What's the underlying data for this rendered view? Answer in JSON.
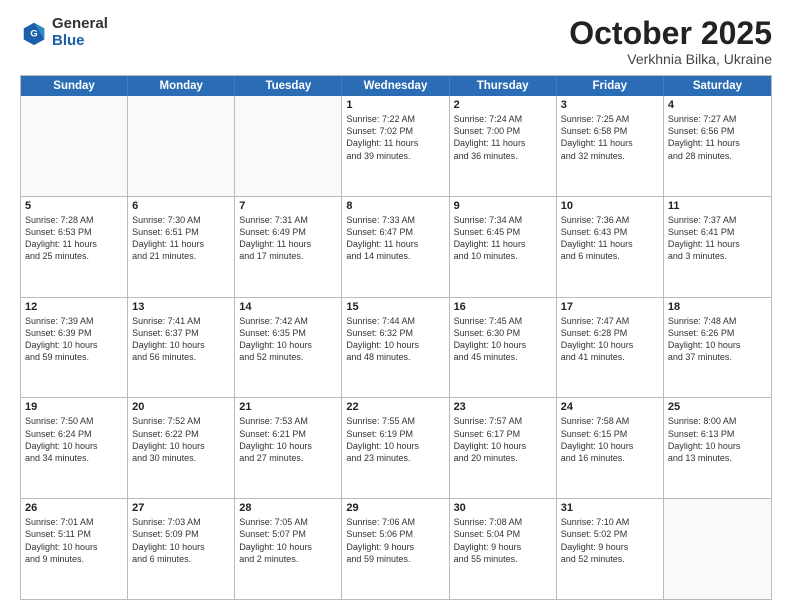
{
  "header": {
    "logo": {
      "general": "General",
      "blue": "Blue"
    },
    "month": "October 2025",
    "location": "Verkhnia Bilka, Ukraine"
  },
  "weekdays": [
    "Sunday",
    "Monday",
    "Tuesday",
    "Wednesday",
    "Thursday",
    "Friday",
    "Saturday"
  ],
  "rows": [
    [
      {
        "day": "",
        "text": "",
        "empty": true
      },
      {
        "day": "",
        "text": "",
        "empty": true
      },
      {
        "day": "",
        "text": "",
        "empty": true
      },
      {
        "day": "1",
        "text": "Sunrise: 7:22 AM\nSunset: 7:02 PM\nDaylight: 11 hours\nand 39 minutes."
      },
      {
        "day": "2",
        "text": "Sunrise: 7:24 AM\nSunset: 7:00 PM\nDaylight: 11 hours\nand 36 minutes."
      },
      {
        "day": "3",
        "text": "Sunrise: 7:25 AM\nSunset: 6:58 PM\nDaylight: 11 hours\nand 32 minutes."
      },
      {
        "day": "4",
        "text": "Sunrise: 7:27 AM\nSunset: 6:56 PM\nDaylight: 11 hours\nand 28 minutes."
      }
    ],
    [
      {
        "day": "5",
        "text": "Sunrise: 7:28 AM\nSunset: 6:53 PM\nDaylight: 11 hours\nand 25 minutes."
      },
      {
        "day": "6",
        "text": "Sunrise: 7:30 AM\nSunset: 6:51 PM\nDaylight: 11 hours\nand 21 minutes."
      },
      {
        "day": "7",
        "text": "Sunrise: 7:31 AM\nSunset: 6:49 PM\nDaylight: 11 hours\nand 17 minutes."
      },
      {
        "day": "8",
        "text": "Sunrise: 7:33 AM\nSunset: 6:47 PM\nDaylight: 11 hours\nand 14 minutes."
      },
      {
        "day": "9",
        "text": "Sunrise: 7:34 AM\nSunset: 6:45 PM\nDaylight: 11 hours\nand 10 minutes."
      },
      {
        "day": "10",
        "text": "Sunrise: 7:36 AM\nSunset: 6:43 PM\nDaylight: 11 hours\nand 6 minutes."
      },
      {
        "day": "11",
        "text": "Sunrise: 7:37 AM\nSunset: 6:41 PM\nDaylight: 11 hours\nand 3 minutes."
      }
    ],
    [
      {
        "day": "12",
        "text": "Sunrise: 7:39 AM\nSunset: 6:39 PM\nDaylight: 10 hours\nand 59 minutes."
      },
      {
        "day": "13",
        "text": "Sunrise: 7:41 AM\nSunset: 6:37 PM\nDaylight: 10 hours\nand 56 minutes."
      },
      {
        "day": "14",
        "text": "Sunrise: 7:42 AM\nSunset: 6:35 PM\nDaylight: 10 hours\nand 52 minutes."
      },
      {
        "day": "15",
        "text": "Sunrise: 7:44 AM\nSunset: 6:32 PM\nDaylight: 10 hours\nand 48 minutes."
      },
      {
        "day": "16",
        "text": "Sunrise: 7:45 AM\nSunset: 6:30 PM\nDaylight: 10 hours\nand 45 minutes."
      },
      {
        "day": "17",
        "text": "Sunrise: 7:47 AM\nSunset: 6:28 PM\nDaylight: 10 hours\nand 41 minutes."
      },
      {
        "day": "18",
        "text": "Sunrise: 7:48 AM\nSunset: 6:26 PM\nDaylight: 10 hours\nand 37 minutes."
      }
    ],
    [
      {
        "day": "19",
        "text": "Sunrise: 7:50 AM\nSunset: 6:24 PM\nDaylight: 10 hours\nand 34 minutes."
      },
      {
        "day": "20",
        "text": "Sunrise: 7:52 AM\nSunset: 6:22 PM\nDaylight: 10 hours\nand 30 minutes."
      },
      {
        "day": "21",
        "text": "Sunrise: 7:53 AM\nSunset: 6:21 PM\nDaylight: 10 hours\nand 27 minutes."
      },
      {
        "day": "22",
        "text": "Sunrise: 7:55 AM\nSunset: 6:19 PM\nDaylight: 10 hours\nand 23 minutes."
      },
      {
        "day": "23",
        "text": "Sunrise: 7:57 AM\nSunset: 6:17 PM\nDaylight: 10 hours\nand 20 minutes."
      },
      {
        "day": "24",
        "text": "Sunrise: 7:58 AM\nSunset: 6:15 PM\nDaylight: 10 hours\nand 16 minutes."
      },
      {
        "day": "25",
        "text": "Sunrise: 8:00 AM\nSunset: 6:13 PM\nDaylight: 10 hours\nand 13 minutes."
      }
    ],
    [
      {
        "day": "26",
        "text": "Sunrise: 7:01 AM\nSunset: 5:11 PM\nDaylight: 10 hours\nand 9 minutes."
      },
      {
        "day": "27",
        "text": "Sunrise: 7:03 AM\nSunset: 5:09 PM\nDaylight: 10 hours\nand 6 minutes."
      },
      {
        "day": "28",
        "text": "Sunrise: 7:05 AM\nSunset: 5:07 PM\nDaylight: 10 hours\nand 2 minutes."
      },
      {
        "day": "29",
        "text": "Sunrise: 7:06 AM\nSunset: 5:06 PM\nDaylight: 9 hours\nand 59 minutes."
      },
      {
        "day": "30",
        "text": "Sunrise: 7:08 AM\nSunset: 5:04 PM\nDaylight: 9 hours\nand 55 minutes."
      },
      {
        "day": "31",
        "text": "Sunrise: 7:10 AM\nSunset: 5:02 PM\nDaylight: 9 hours\nand 52 minutes."
      },
      {
        "day": "",
        "text": "",
        "empty": true
      }
    ]
  ]
}
